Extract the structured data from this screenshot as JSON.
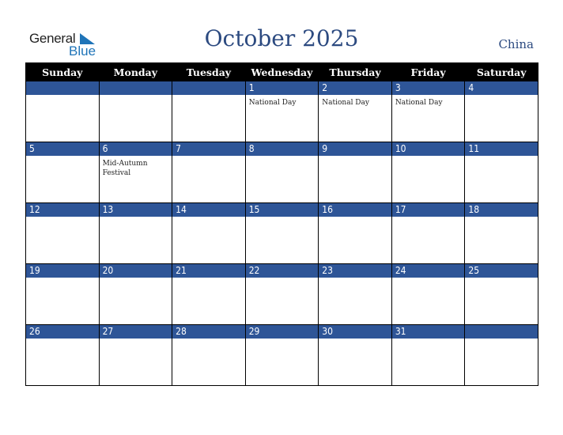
{
  "logo": {
    "general": "General",
    "blue": "Blue"
  },
  "header": {
    "title": "October 2025",
    "country": "China"
  },
  "weekdays": [
    "Sunday",
    "Monday",
    "Tuesday",
    "Wednesday",
    "Thursday",
    "Friday",
    "Saturday"
  ],
  "colors": {
    "header_bg": "#000000",
    "daynum_bg": "#2e5597",
    "title": "#2c4a80",
    "logo_blue": "#1f74b8"
  },
  "weeks": [
    [
      {
        "day": "",
        "event": ""
      },
      {
        "day": "",
        "event": ""
      },
      {
        "day": "",
        "event": ""
      },
      {
        "day": "1",
        "event": "National Day"
      },
      {
        "day": "2",
        "event": "National Day"
      },
      {
        "day": "3",
        "event": "National Day"
      },
      {
        "day": "4",
        "event": ""
      }
    ],
    [
      {
        "day": "5",
        "event": ""
      },
      {
        "day": "6",
        "event": "Mid-Autumn Festival"
      },
      {
        "day": "7",
        "event": ""
      },
      {
        "day": "8",
        "event": ""
      },
      {
        "day": "9",
        "event": ""
      },
      {
        "day": "10",
        "event": ""
      },
      {
        "day": "11",
        "event": ""
      }
    ],
    [
      {
        "day": "12",
        "event": ""
      },
      {
        "day": "13",
        "event": ""
      },
      {
        "day": "14",
        "event": ""
      },
      {
        "day": "15",
        "event": ""
      },
      {
        "day": "16",
        "event": ""
      },
      {
        "day": "17",
        "event": ""
      },
      {
        "day": "18",
        "event": ""
      }
    ],
    [
      {
        "day": "19",
        "event": ""
      },
      {
        "day": "20",
        "event": ""
      },
      {
        "day": "21",
        "event": ""
      },
      {
        "day": "22",
        "event": ""
      },
      {
        "day": "23",
        "event": ""
      },
      {
        "day": "24",
        "event": ""
      },
      {
        "day": "25",
        "event": ""
      }
    ],
    [
      {
        "day": "26",
        "event": ""
      },
      {
        "day": "27",
        "event": ""
      },
      {
        "day": "28",
        "event": ""
      },
      {
        "day": "29",
        "event": ""
      },
      {
        "day": "30",
        "event": ""
      },
      {
        "day": "31",
        "event": ""
      },
      {
        "day": "",
        "event": ""
      }
    ]
  ]
}
